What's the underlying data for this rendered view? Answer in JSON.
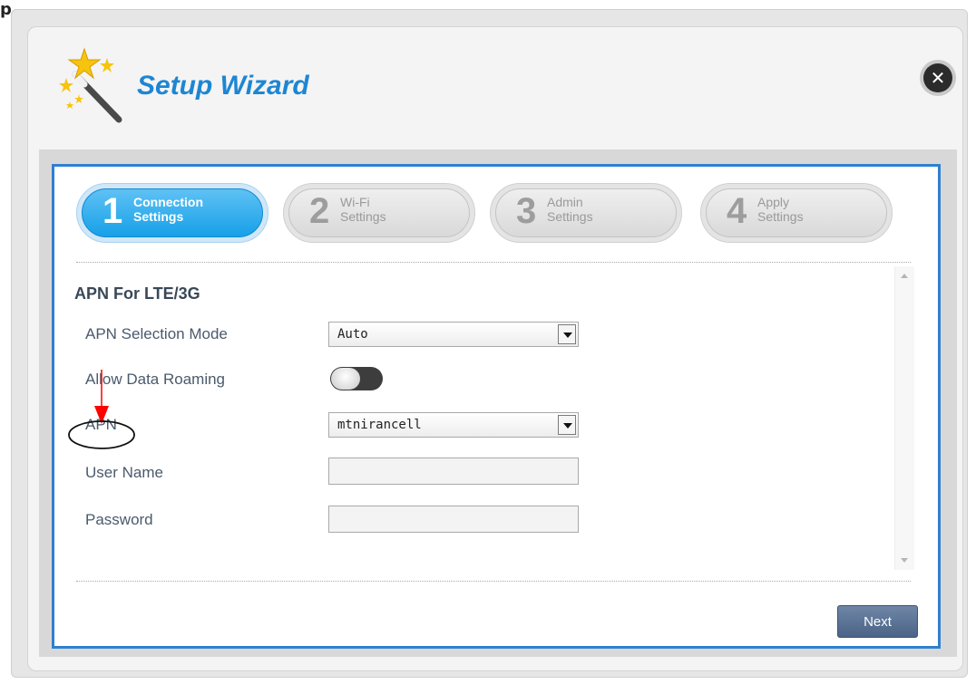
{
  "background": {
    "corner_text": "p..."
  },
  "dialog": {
    "title": "Setup Wizard",
    "close_icon": "close-icon",
    "steps": [
      {
        "number": "1",
        "line1": "Connection",
        "line2": "Settings",
        "active": true
      },
      {
        "number": "2",
        "line1": "Wi-Fi",
        "line2": "Settings",
        "active": false
      },
      {
        "number": "3",
        "line1": "Admin",
        "line2": "Settings",
        "active": false
      },
      {
        "number": "4",
        "line1": "Apply",
        "line2": "Settings",
        "active": false
      }
    ],
    "section_title": "APN For LTE/3G",
    "fields": {
      "apn_selection_mode": {
        "label": "APN Selection Mode",
        "value": "Auto"
      },
      "allow_data_roaming": {
        "label": "Allow Data Roaming",
        "state": "off"
      },
      "apn": {
        "label": "APN",
        "value": "mtnirancell"
      },
      "user_name": {
        "label": "User Name",
        "value": ""
      },
      "password": {
        "label": "Password",
        "value": ""
      }
    },
    "next_label": "Next"
  },
  "colors": {
    "accent": "#1d86d3",
    "frame_border": "#2f7fd2",
    "active_step": "#16a0e8",
    "next_button": "#4a6487",
    "annotation_arrow": "#ff0000"
  }
}
